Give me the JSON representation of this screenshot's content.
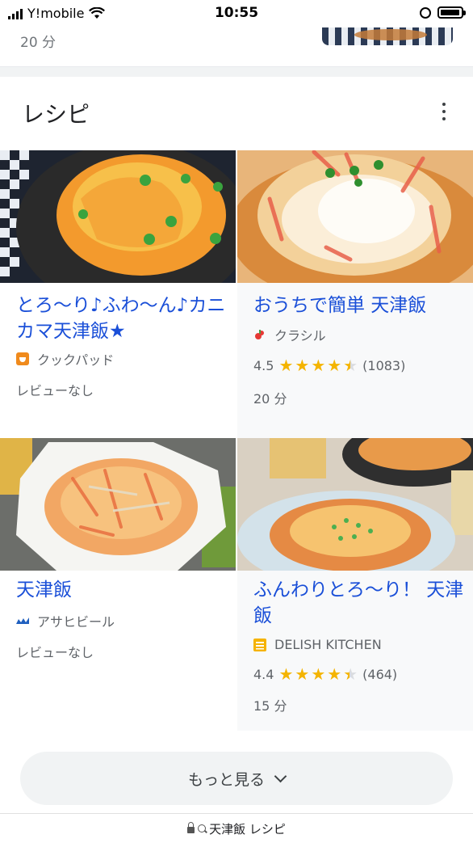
{
  "status_bar": {
    "carrier": "Y!mobile",
    "time": "10:55"
  },
  "previous_card": {
    "time": "20 分"
  },
  "section": {
    "title": "レシピ"
  },
  "recipes": [
    {
      "title": "とろ～り♪ふわ～ん♪カニカマ天津飯★",
      "source": "クックパッド",
      "rating": "",
      "review_count": "",
      "time": "",
      "note": "レビューなし"
    },
    {
      "title": "おうちで簡単 天津飯",
      "source": "クラシル",
      "rating": "4.5",
      "stars": 4.5,
      "review_count": "(1083)",
      "time": "20 分",
      "note": ""
    },
    {
      "title": "天津飯",
      "source": "アサヒビール",
      "rating": "",
      "review_count": "",
      "time": "",
      "note": "レビューなし"
    },
    {
      "title": "ふんわりとろ～り！ 天津飯",
      "source": "DELISH KITCHEN",
      "rating": "4.4",
      "stars": 4.4,
      "review_count": "(464)",
      "time": "15 分",
      "note": ""
    }
  ],
  "more_button": {
    "label": "もっと見る"
  },
  "url_bar": {
    "query": "天津飯 レシピ"
  },
  "colors": {
    "link": "#1a4fd8",
    "star": "#f4b400",
    "muted": "#5f6368"
  }
}
